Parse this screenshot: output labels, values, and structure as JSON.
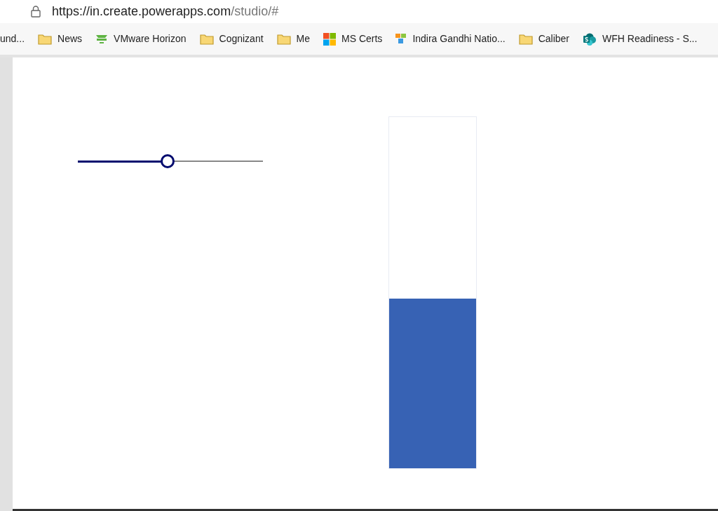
{
  "address_bar": {
    "url_host": "https://in.create.powerapps.com",
    "url_path": "/studio/#"
  },
  "bookmarks": [
    {
      "kind": "plain",
      "label": "und..."
    },
    {
      "kind": "folder",
      "label": "News"
    },
    {
      "kind": "monitor",
      "label": "VMware Horizon"
    },
    {
      "kind": "folder",
      "label": "Cognizant"
    },
    {
      "kind": "folder",
      "label": "Me"
    },
    {
      "kind": "tiles",
      "label": "MS Certs"
    },
    {
      "kind": "blocks",
      "label": "Indira Gandhi Natio..."
    },
    {
      "kind": "folder",
      "label": "Caliber"
    },
    {
      "kind": "sharepoint",
      "label": "WFH Readiness - S..."
    }
  ],
  "canvas": {
    "slider": {
      "level": 0.485
    },
    "vertical_slider": {
      "level": 0.484
    }
  }
}
